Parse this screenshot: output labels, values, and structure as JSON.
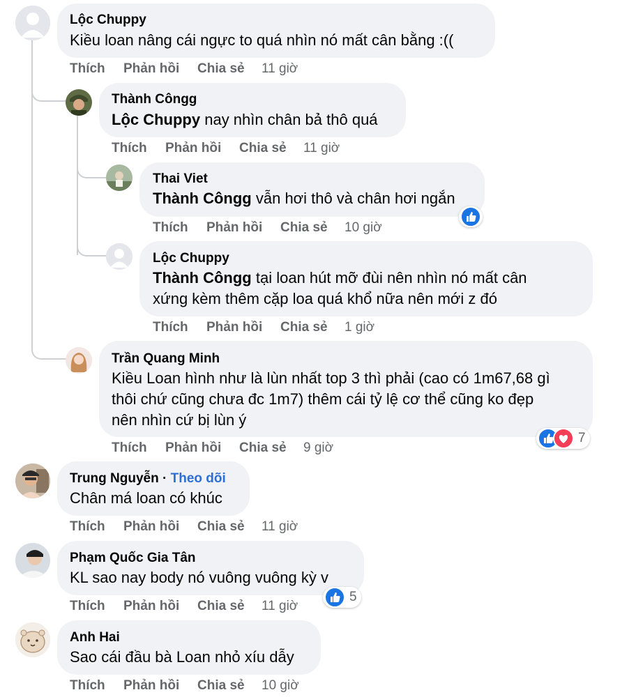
{
  "actions": {
    "like": "Thích",
    "reply": "Phản hồi",
    "share": "Chia sẻ"
  },
  "comments": [
    {
      "author": "Lộc Chuppy",
      "text": "Kiều loan nâng cái ngực to quá nhìn nó mất cân bằng :((",
      "time": "11 giờ"
    },
    {
      "author": "Thành Côngg",
      "mention": "Lộc Chuppy",
      "text": " nay nhìn chân bả thô quá",
      "time": "11 giờ"
    },
    {
      "author": "Thai Viet",
      "mention": "Thành Côngg",
      "text": " vẫn hơi thô và chân hơi ngắn",
      "time": "10 giờ"
    },
    {
      "author": "Lộc Chuppy",
      "mention": "Thành Côngg",
      "text": " tại loan hút mỡ đùi nên nhìn nó mất cân",
      "text2": "xứng kèm thêm cặp loa quá khổ nữa nên mới z đó",
      "time": "1 giờ"
    },
    {
      "author": "Trần Quang Minh",
      "text": "Kiều Loan hình như là lùn nhất top 3 thì phải (cao có 1m67,68 gì",
      "text2": "thôi chứ cũng chưa đc 1m7) thêm cái tỷ lệ cơ thể cũng ko đẹp",
      "text3": "nên nhìn cứ bị lùn ý",
      "time": "9 giờ",
      "reaction_count": "7"
    },
    {
      "author": "Trung Nguyễn",
      "separator": "·",
      "follow": "Theo dõi",
      "text": "Chân má loan có khúc",
      "time": "11 giờ"
    },
    {
      "author": "Phạm Quốc Gia Tân",
      "text": "KL sao nay body nó vuông vuông kỳ v",
      "time": "11 giờ",
      "reaction_count": "5"
    },
    {
      "author": "Anh Hai",
      "text": "Sao cái đầu bà Loan nhỏ xíu dẫy",
      "time": "10 giờ"
    }
  ],
  "colors": {
    "bubble": "#f0f2f5",
    "meta": "#65676b",
    "link": "#2d6fd3",
    "like": "#1b74e4",
    "love": "#f33e58"
  }
}
